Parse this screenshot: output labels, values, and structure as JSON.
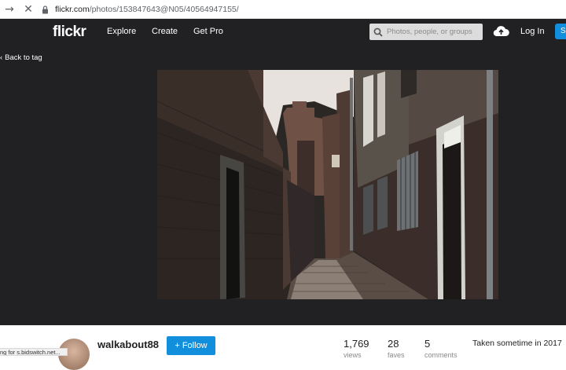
{
  "browser": {
    "url_host": "flickr.com",
    "url_path": "/photos/153847643@N05/40564947155/"
  },
  "header": {
    "logo": "flickr",
    "nav": [
      "Explore",
      "Create",
      "Get Pro"
    ],
    "search_placeholder": "Photos, people, or groups",
    "login": "Log In",
    "signup_partial": "S"
  },
  "photo_page": {
    "back_label": "Back to tag"
  },
  "info": {
    "username": "walkabout88",
    "follow_label": "+ Follow",
    "stats": [
      {
        "value": "1,769",
        "label": "views"
      },
      {
        "value": "28",
        "label": "faves"
      },
      {
        "value": "5",
        "label": "comments"
      }
    ],
    "taken": "Taken sometime in 2017"
  },
  "status_bar": "ng for s.bidswitch.net...",
  "colors": {
    "header_bg": "#212124",
    "accent": "#128fdc"
  }
}
